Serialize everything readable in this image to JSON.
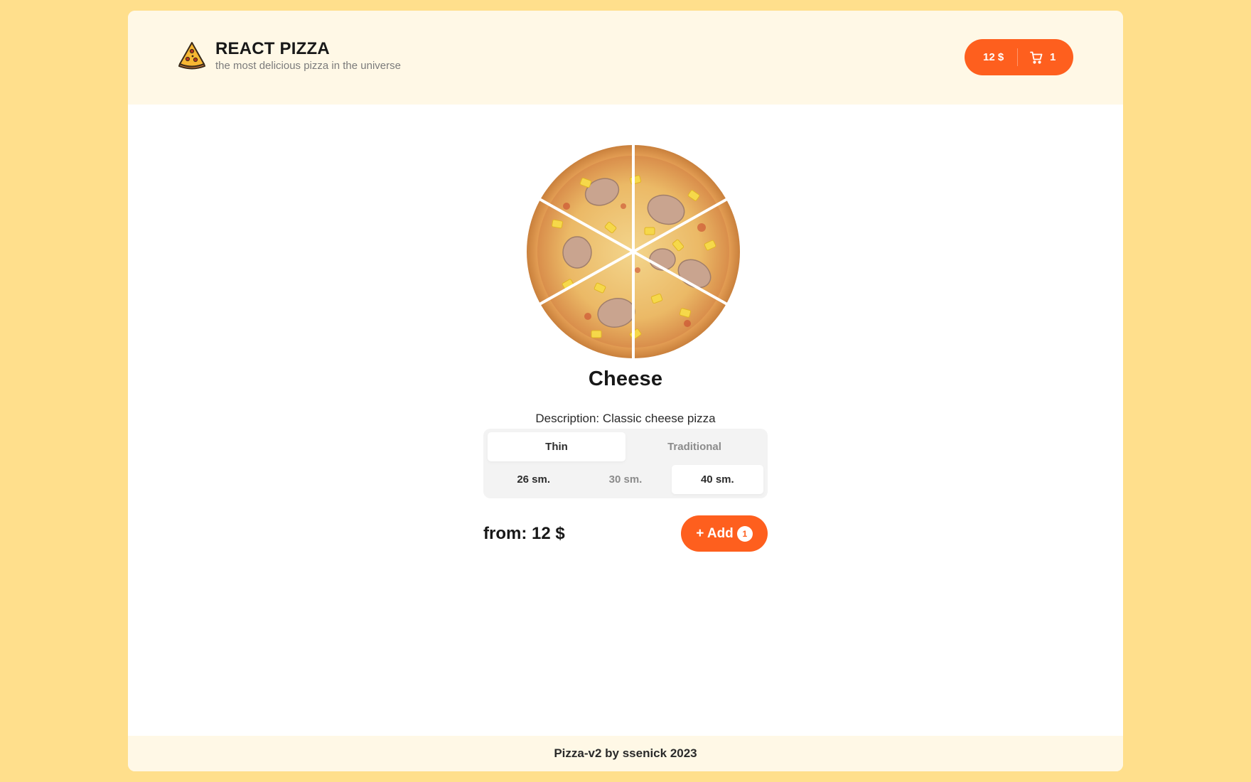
{
  "header": {
    "logo_icon": "pizza-slice-icon",
    "title": "REACT PIZZA",
    "subtitle": "the most delicious pizza in the universe",
    "cart": {
      "price": "12 $",
      "count": "1",
      "icon": "cart-icon"
    }
  },
  "product": {
    "image": "pizza-photo",
    "title": "Cheese",
    "description": "Description: Classic cheese pizza",
    "types": [
      "Thin",
      "Traditional"
    ],
    "selected_type": "Thin",
    "sizes": [
      "26 sm.",
      "30 sm.",
      "40 sm."
    ],
    "selected_size": "40 sm.",
    "price": "from: 12 $",
    "add_label": "+ Add",
    "add_count": "1"
  },
  "footer": {
    "text": "Pizza-v2 by ssenick 2023"
  },
  "colors": {
    "accent": "#FE5F1E",
    "page_bg": "#FFDF8C",
    "header_bg": "#FFF8E6"
  }
}
